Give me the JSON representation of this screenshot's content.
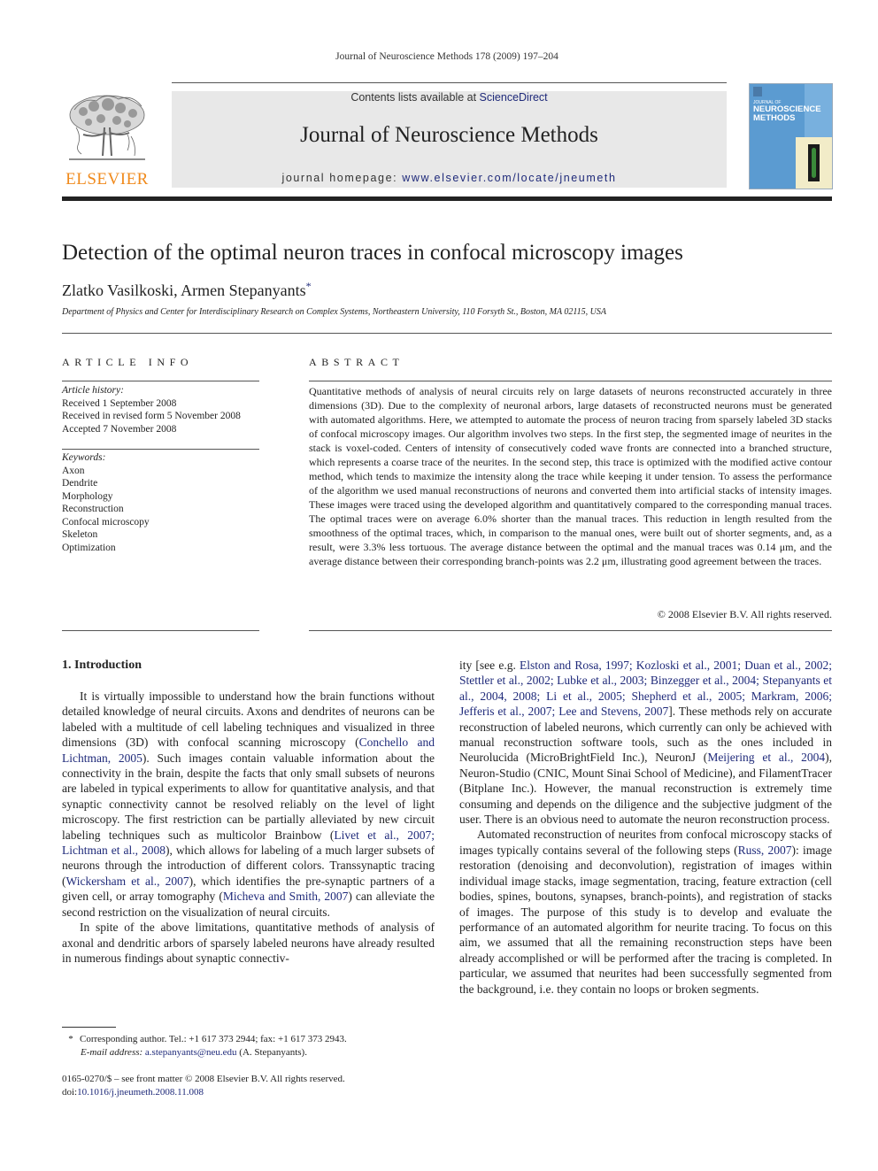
{
  "running_head": "Journal of Neuroscience Methods 178 (2009) 197–204",
  "publisher": {
    "logo_word": "ELSEVIER",
    "logo_color": "#f08a1c"
  },
  "masthead": {
    "contents_prefix": "Contents lists available at ",
    "contents_link": "ScienceDirect",
    "journal_name": "Journal of Neuroscience Methods",
    "homepage_prefix": "journal homepage: ",
    "homepage_link": "www.elsevier.com/locate/jneumeth"
  },
  "cover": {
    "small_text": "JOURNAL OF",
    "big_line1": "NEUROSCIENCE",
    "big_line2": "METHODS"
  },
  "article": {
    "title": "Detection of the optimal neuron traces in confocal microscopy images",
    "authors": "Zlatko Vasilkoski, Armen Stepanyants",
    "author_mark": "*",
    "affiliation": "Department of Physics and Center for Interdisciplinary Research on Complex Systems, Northeastern University, 110 Forsyth St., Boston, MA 02115, USA"
  },
  "article_info": {
    "heading": "ARTICLE INFO",
    "history_label": "Article history:",
    "history": [
      "Received 1 September 2008",
      "Received in revised form 5 November 2008",
      "Accepted 7 November 2008"
    ],
    "keywords_label": "Keywords:",
    "keywords": [
      "Axon",
      "Dendrite",
      "Morphology",
      "Reconstruction",
      "Confocal microscopy",
      "Skeleton",
      "Optimization"
    ]
  },
  "abstract": {
    "heading": "ABSTRACT",
    "text": "Quantitative methods of analysis of neural circuits rely on large datasets of neurons reconstructed accurately in three dimensions (3D). Due to the complexity of neuronal arbors, large datasets of reconstructed neurons must be generated with automated algorithms. Here, we attempted to automate the process of neuron tracing from sparsely labeled 3D stacks of confocal microscopy images. Our algorithm involves two steps. In the first step, the segmented image of neurites in the stack is voxel-coded. Centers of intensity of consecutively coded wave fronts are connected into a branched structure, which represents a coarse trace of the neurites. In the second step, this trace is optimized with the modified active contour method, which tends to maximize the intensity along the trace while keeping it under tension. To assess the performance of the algorithm we used manual reconstructions of neurons and converted them into artificial stacks of intensity images. These images were traced using the developed algorithm and quantitatively compared to the corresponding manual traces. The optimal traces were on average 6.0% shorter than the manual traces. This reduction in length resulted from the smoothness of the optimal traces, which, in comparison to the manual ones, were built out of shorter segments, and, as a result, were 3.3% less tortuous. The average distance between the optimal and the manual traces was 0.14 μm, and the average distance between their corresponding branch-points was 2.2 μm, illustrating good agreement between the traces.",
    "copyright": "© 2008 Elsevier B.V. All rights reserved."
  },
  "introduction": {
    "heading": "1.  Introduction",
    "p1": [
      {
        "t": "It is virtually impossible to understand how the brain functions without detailed knowledge of neural circuits. Axons and dendrites of neurons can be labeled with a multitude of cell labeling techniques and visualized in three dimensions (3D) with confocal scanning microscopy ("
      },
      {
        "link": "Conchello and Lichtman, 2005"
      },
      {
        "t": "). Such images contain valuable information about the connectivity in the brain, despite the facts that only small subsets of neurons are labeled in typical experiments to allow for quantitative analysis, and that synaptic connectivity cannot be resolved reliably on the level of light microscopy. The first restriction can be partially alleviated by new circuit labeling techniques such as multicolor Brainbow ("
      },
      {
        "link": "Livet et al., 2007; Lichtman et al., 2008"
      },
      {
        "t": "), which allows for labeling of a much larger subsets of neurons through the introduction of different colors. Transsynaptic tracing ("
      },
      {
        "link": "Wickersham et al., 2007"
      },
      {
        "t": "), which identifies the pre-synaptic partners of a given cell, or array tomography ("
      },
      {
        "link": "Micheva and Smith, 2007"
      },
      {
        "t": ") can alleviate the second restriction on the visualization of neural circuits."
      }
    ],
    "p2_start": "In spite of the above limitations, quantitative methods of analysis of axonal and dendritic arbors of sparsely labeled neurons have already resulted in numerous findings about synaptic connectiv-",
    "p2_cont": [
      {
        "t": "ity [see e.g. "
      },
      {
        "link": "Elston and Rosa, 1997; Kozloski et al., 2001; Duan et al., 2002; Stettler et al., 2002; Lubke et al., 2003; Binzegger et al., 2004; Stepanyants et al., 2004, 2008; Li et al., 2005; Shepherd et al., 2005; Markram, 2006; Jefferis et al., 2007; Lee and Stevens, 2007"
      },
      {
        "t": "]. These methods rely on accurate reconstruction of labeled neurons, which currently can only be achieved with manual reconstruction software tools, such as the ones included in Neurolucida (MicroBrightField Inc.), NeuronJ ("
      },
      {
        "link": "Meijering et al., 2004"
      },
      {
        "t": "), Neuron-Studio (CNIC, Mount Sinai School of Medicine), and FilamentTracer (Bitplane Inc.). However, the manual reconstruction is extremely time consuming and depends on the diligence and the subjective judgment of the user. There is an obvious need to automate the neuron reconstruction process."
      }
    ],
    "p3": [
      {
        "t": "Automated reconstruction of neurites from confocal microscopy stacks of images typically contains several of the following steps ("
      },
      {
        "link": "Russ, 2007"
      },
      {
        "t": "): image restoration (denoising and deconvolution), registration of images within individual image stacks, image segmentation, tracing, feature extraction (cell bodies, spines, boutons, synapses, branch-points), and registration of stacks of images. The purpose of this study is to develop and evaluate the performance of an automated algorithm for neurite tracing. To focus on this aim, we assumed that all the remaining reconstruction steps have been already accomplished or will be performed after the tracing is completed. In particular, we assumed that neurites had been successfully segmented from the background, i.e. they contain no loops or broken segments."
      }
    ]
  },
  "footnote": {
    "star": "*",
    "corresponding": "Corresponding author. Tel.: +1 617 373 2944; fax: +1 617 373 2943.",
    "email_label": "E-mail address:",
    "email": "a.stepanyants@neu.edu",
    "email_suffix": " (A. Stepanyants)."
  },
  "issn": {
    "line": "0165-0270/$ – see front matter © 2008 Elsevier B.V. All rights reserved.",
    "doi_prefix": "doi:",
    "doi": "10.1016/j.jneumeth.2008.11.008"
  },
  "colors": {
    "link": "#1f2a7a",
    "masthead_bg": "#e8e8e8",
    "cover_blue": "#5b9bd1"
  }
}
